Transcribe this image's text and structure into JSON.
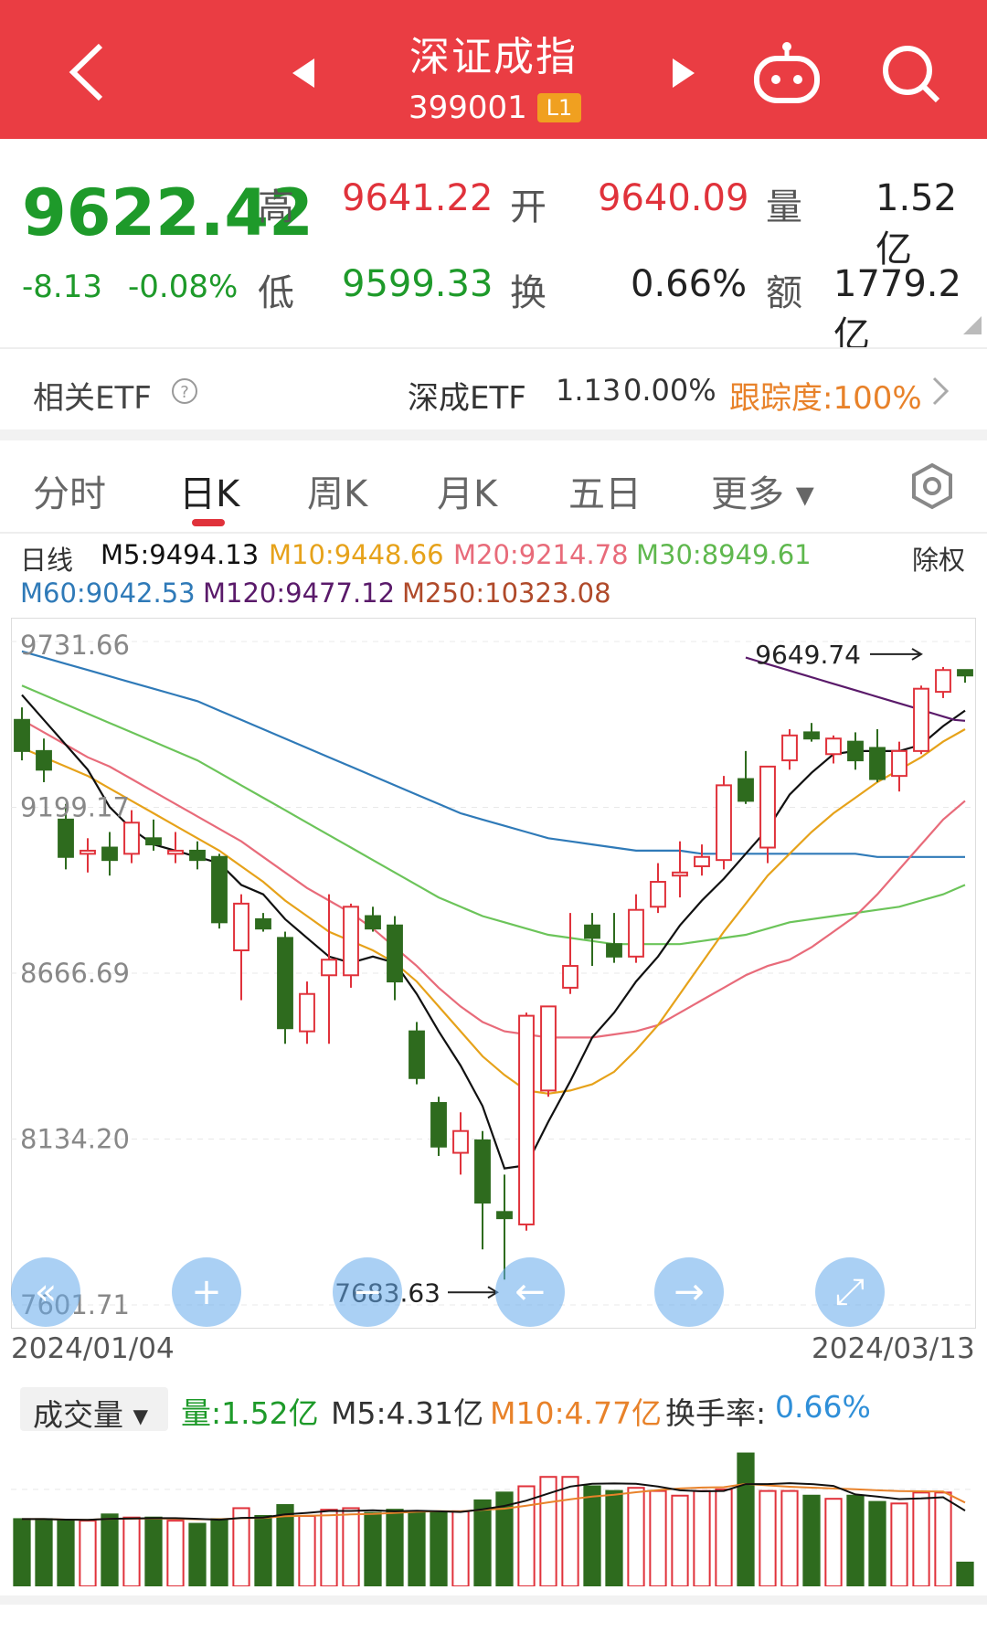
{
  "header": {
    "back_icon": "chevron-left-icon",
    "prev_icon": "triangle-left-icon",
    "title": "深证成指",
    "code": "399001",
    "level_badge": "L1",
    "next_icon": "triangle-right-icon",
    "robot_icon": "robot-icon",
    "search_icon": "search-icon"
  },
  "quote": {
    "price": "9622.42",
    "change": "-8.13",
    "change_pct": "-0.08%",
    "high_label": "高",
    "high": "9641.22",
    "open_label": "开",
    "open": "9640.09",
    "volume_label": "量",
    "volume": "1.52亿",
    "low_label": "低",
    "low": "9599.33",
    "turnover_label": "换",
    "turnover": "0.66%",
    "amount_label": "额",
    "amount": "1779.2亿"
  },
  "etf": {
    "label": "相关ETF",
    "help_icon": "question-circle-icon",
    "name": "深成ETF",
    "price": "1.13",
    "pct": "0.00%",
    "tracking": "跟踪度:100%",
    "arrow_icon": "chevron-right-icon"
  },
  "tabs": [
    {
      "label": "分时",
      "active": false
    },
    {
      "label": "日K",
      "active": true
    },
    {
      "label": "周K",
      "active": false
    },
    {
      "label": "月K",
      "active": false
    },
    {
      "label": "五日",
      "active": false
    },
    {
      "label": "更多 ▾",
      "active": false
    }
  ],
  "settings_icon": "hexagon-gear-icon",
  "ma_legend": {
    "label": "日线",
    "m5": "M5:9494.13",
    "m10": "M10:9448.66",
    "m20": "M20:9214.78",
    "m30": "M30:8949.61",
    "fq": "除权",
    "m60": "M60:9042.53",
    "m120": "M120:9477.12",
    "m250": "M250:10323.08"
  },
  "colors": {
    "up": "#e0323b",
    "down": "#2e6b1e",
    "m5": "#111111",
    "m10": "#e6a21a",
    "m20": "#e86b7a",
    "m30": "#6cc45a",
    "m60": "#2f7ab8",
    "m120": "#5a1a6a",
    "m250": "#b04a2a"
  },
  "chart_data": {
    "type": "candlestick",
    "y_ticks": [
      "9731.66",
      "9199.17",
      "8666.69",
      "8134.20",
      "7601.71"
    ],
    "ylim": [
      7601.71,
      9731.66
    ],
    "x_start": "2024/01/04",
    "x_end": "2024/03/13",
    "max_label": "9649.74",
    "min_label": "7683.63",
    "candles": [
      {
        "o": 9480,
        "h": 9520,
        "l": 9350,
        "c": 9380
      },
      {
        "o": 9380,
        "h": 9420,
        "l": 9280,
        "c": 9320
      },
      {
        "o": 9160,
        "h": 9210,
        "l": 9000,
        "c": 9040
      },
      {
        "o": 9050,
        "h": 9100,
        "l": 8990,
        "c": 9060
      },
      {
        "o": 9070,
        "h": 9120,
        "l": 8980,
        "c": 9030
      },
      {
        "o": 9050,
        "h": 9190,
        "l": 9020,
        "c": 9150
      },
      {
        "o": 9100,
        "h": 9160,
        "l": 9060,
        "c": 9080
      },
      {
        "o": 9050,
        "h": 9120,
        "l": 9020,
        "c": 9060
      },
      {
        "o": 9060,
        "h": 9090,
        "l": 9000,
        "c": 9030
      },
      {
        "o": 9040,
        "h": 9050,
        "l": 8810,
        "c": 8830
      },
      {
        "o": 8740,
        "h": 8920,
        "l": 8580,
        "c": 8890
      },
      {
        "o": 8840,
        "h": 8860,
        "l": 8800,
        "c": 8810
      },
      {
        "o": 8780,
        "h": 8800,
        "l": 8440,
        "c": 8490
      },
      {
        "o": 8480,
        "h": 8640,
        "l": 8440,
        "c": 8600
      },
      {
        "o": 8660,
        "h": 8920,
        "l": 8440,
        "c": 8710
      },
      {
        "o": 8660,
        "h": 8890,
        "l": 8620,
        "c": 8880
      },
      {
        "o": 8850,
        "h": 8880,
        "l": 8800,
        "c": 8810
      },
      {
        "o": 8820,
        "h": 8850,
        "l": 8580,
        "c": 8640
      },
      {
        "o": 8480,
        "h": 8510,
        "l": 8310,
        "c": 8330
      },
      {
        "o": 8250,
        "h": 8270,
        "l": 8080,
        "c": 8110
      },
      {
        "o": 8090,
        "h": 8220,
        "l": 8020,
        "c": 8160
      },
      {
        "o": 8130,
        "h": 8160,
        "l": 7780,
        "c": 7930
      },
      {
        "o": 7900,
        "h": 8020,
        "l": 7683,
        "c": 7880
      },
      {
        "o": 7860,
        "h": 8540,
        "l": 7840,
        "c": 8530
      },
      {
        "o": 8290,
        "h": 8560,
        "l": 8270,
        "c": 8560
      },
      {
        "o": 8620,
        "h": 8860,
        "l": 8600,
        "c": 8690
      },
      {
        "o": 8820,
        "h": 8860,
        "l": 8690,
        "c": 8780
      },
      {
        "o": 8760,
        "h": 8860,
        "l": 8700,
        "c": 8720
      },
      {
        "o": 8720,
        "h": 8920,
        "l": 8700,
        "c": 8870
      },
      {
        "o": 8880,
        "h": 9020,
        "l": 8860,
        "c": 8960
      },
      {
        "o": 8980,
        "h": 9090,
        "l": 8910,
        "c": 8990
      },
      {
        "o": 9010,
        "h": 9080,
        "l": 8980,
        "c": 9040
      },
      {
        "o": 9030,
        "h": 9300,
        "l": 9000,
        "c": 9270
      },
      {
        "o": 9290,
        "h": 9380,
        "l": 9210,
        "c": 9220
      },
      {
        "o": 9070,
        "h": 9330,
        "l": 9020,
        "c": 9330
      },
      {
        "o": 9350,
        "h": 9450,
        "l": 9320,
        "c": 9430
      },
      {
        "o": 9440,
        "h": 9470,
        "l": 9410,
        "c": 9420
      },
      {
        "o": 9370,
        "h": 9430,
        "l": 9340,
        "c": 9420
      },
      {
        "o": 9410,
        "h": 9440,
        "l": 9320,
        "c": 9350
      },
      {
        "o": 9390,
        "h": 9450,
        "l": 9280,
        "c": 9290
      },
      {
        "o": 9300,
        "h": 9410,
        "l": 9250,
        "c": 9380
      },
      {
        "o": 9380,
        "h": 9590,
        "l": 9370,
        "c": 9580
      },
      {
        "o": 9570,
        "h": 9649.74,
        "l": 9550,
        "c": 9640
      },
      {
        "o": 9640.09,
        "h": 9641.22,
        "l": 9599.33,
        "c": 9622.42
      }
    ],
    "ma_lines": {
      "m5": [
        9560,
        9480,
        9400,
        9320,
        9200,
        9130,
        9080,
        9060,
        9040,
        9020,
        8950,
        8920,
        8840,
        8780,
        8720,
        8700,
        8720,
        8700,
        8600,
        8480,
        8370,
        8240,
        8040,
        8050,
        8190,
        8320,
        8460,
        8540,
        8640,
        8720,
        8820,
        8900,
        8970,
        9050,
        9130,
        9240,
        9310,
        9370,
        9380,
        9380,
        9380,
        9400,
        9460,
        9510
      ],
      "m10": [
        9390,
        9360,
        9330,
        9300,
        9260,
        9220,
        9180,
        9140,
        9100,
        9060,
        9010,
        8960,
        8900,
        8850,
        8800,
        8770,
        8740,
        8700,
        8640,
        8560,
        8480,
        8400,
        8340,
        8290,
        8280,
        8290,
        8310,
        8350,
        8420,
        8500,
        8600,
        8700,
        8800,
        8890,
        8980,
        9050,
        9120,
        9180,
        9230,
        9280,
        9320,
        9360,
        9410,
        9450
      ],
      "m20": [
        9480,
        9440,
        9400,
        9360,
        9330,
        9290,
        9250,
        9210,
        9170,
        9130,
        9090,
        9040,
        8990,
        8940,
        8900,
        8860,
        8810,
        8750,
        8690,
        8620,
        8560,
        8510,
        8480,
        8470,
        8460,
        8460,
        8460,
        8470,
        8480,
        8500,
        8540,
        8580,
        8620,
        8660,
        8690,
        8710,
        8750,
        8800,
        8850,
        8920,
        9000,
        9080,
        9160,
        9220
      ],
      "m30": [
        9590,
        9560,
        9530,
        9500,
        9470,
        9440,
        9410,
        9380,
        9350,
        9310,
        9270,
        9230,
        9190,
        9150,
        9110,
        9070,
        9030,
        8990,
        8950,
        8910,
        8880,
        8850,
        8830,
        8810,
        8790,
        8780,
        8770,
        8760,
        8760,
        8760,
        8760,
        8770,
        8780,
        8790,
        8810,
        8830,
        8840,
        8850,
        8860,
        8870,
        8880,
        8900,
        8920,
        8950
      ],
      "m60": [
        9700,
        9680,
        9660,
        9640,
        9620,
        9600,
        9580,
        9560,
        9540,
        9510,
        9480,
        9450,
        9420,
        9390,
        9360,
        9330,
        9300,
        9270,
        9240,
        9210,
        9180,
        9160,
        9140,
        9120,
        9100,
        9090,
        9080,
        9070,
        9060,
        9060,
        9060,
        9050,
        9050,
        9050,
        9050,
        9050,
        9050,
        9050,
        9050,
        9040,
        9040,
        9040,
        9040,
        9040
      ],
      "m120_start": 33,
      "m120": [
        9680,
        9670,
        9660,
        9650,
        9640,
        9630,
        9620,
        9610,
        9600,
        9590,
        9580,
        9570,
        9560,
        9550,
        9540,
        9530,
        9520,
        9510,
        9500,
        9490,
        9480,
        9477.12
      ]
    },
    "volume": {
      "legend_label": "成交量 ▾",
      "amount": "量:1.52亿",
      "m5": "M5:4.31亿",
      "m10": "M10:4.77亿",
      "turnover_label": "换手率:",
      "turnover": "0.66%",
      "bars": [
        4.3,
        4.3,
        4.2,
        4.2,
        4.6,
        4.4,
        4.4,
        4.2,
        4.0,
        4.3,
        5.0,
        4.5,
        5.2,
        4.5,
        4.9,
        5.0,
        4.7,
        4.9,
        4.7,
        4.7,
        4.8,
        5.5,
        6.0,
        6.4,
        7.0,
        7.0,
        6.4,
        6.1,
        6.3,
        6.1,
        5.8,
        6.1,
        6.2,
        8.5,
        6.1,
        6.1,
        5.8,
        5.6,
        5.8,
        5.4,
        5.3,
        6.0,
        6.0,
        1.52
      ],
      "ylim": [
        0,
        9
      ]
    }
  },
  "zoom_controls": [
    {
      "name": "collapse-left-button",
      "icon": "«"
    },
    {
      "name": "zoom-in-button",
      "icon": "+"
    },
    {
      "name": "zoom-out-button",
      "icon": "−"
    },
    {
      "name": "scroll-left-button",
      "icon": "←"
    },
    {
      "name": "scroll-right-button",
      "icon": "→"
    },
    {
      "name": "fullscreen-button",
      "icon": "⤢"
    }
  ]
}
